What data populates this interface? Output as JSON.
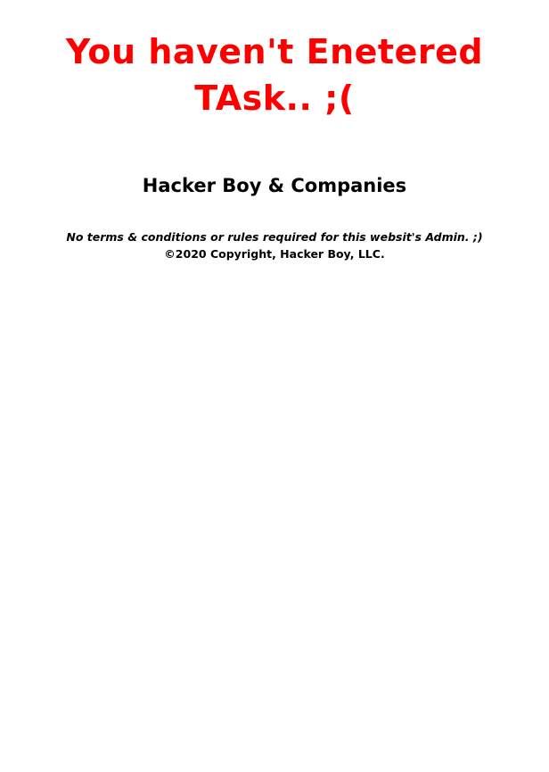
{
  "colors": {
    "headline": "#ff0000",
    "text": "#000000",
    "background": "#ffffff"
  },
  "headline": "You haven't Enetered TAsk.. ;(",
  "company": "Hacker Boy & Companies",
  "footer": {
    "terms": "No terms & conditions or rules required for this websit's Admin. ;)",
    "copyright": "©2020 Copyright, Hacker Boy, LLC."
  }
}
